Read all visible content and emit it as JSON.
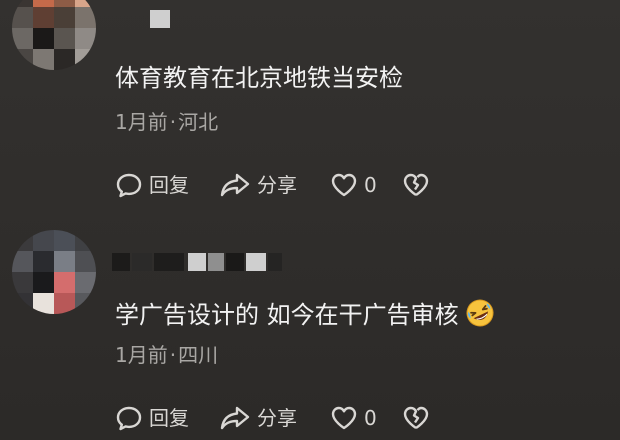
{
  "comments": [
    {
      "text": "体育教育在北京地铁当安检",
      "time": "1月前",
      "separator": "·",
      "location": "河北",
      "actions": {
        "reply_label": "回复",
        "share_label": "分享",
        "like_count": "0"
      }
    },
    {
      "text": "学广告设计的 如今在干广告审核",
      "emoji_icon": "rolling-on-floor-laughing-emoji",
      "time": "1月前",
      "separator": "·",
      "location": "四川",
      "actions": {
        "reply_label": "回复",
        "share_label": "分享",
        "like_count": "0"
      }
    }
  ],
  "colors": {
    "background": "#2f2d2b",
    "comment_text": "#f2f2f2",
    "meta_text": "#a9a7a4",
    "action_text": "#d9d7d4"
  }
}
